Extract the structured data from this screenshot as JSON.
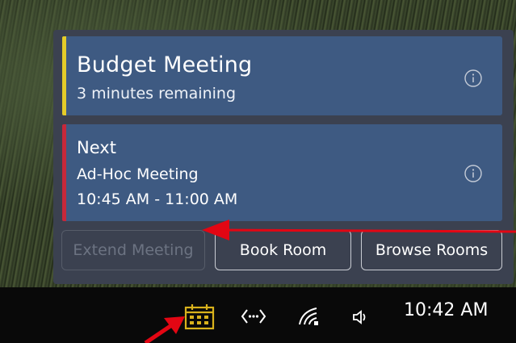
{
  "flyout": {
    "current": {
      "title": "Budget Meeting",
      "status": "3 minutes remaining",
      "accent_color": "#e4cc29",
      "icon": "info-icon"
    },
    "next": {
      "heading": "Next",
      "title": "Ad-Hoc Meeting",
      "time": "10:45 AM - 11:00 AM",
      "accent_color": "#c7283a",
      "icon": "info-icon"
    },
    "buttons": {
      "extend": "Extend Meeting",
      "book": "Book Room",
      "browse": "Browse Rooms"
    }
  },
  "taskbar": {
    "icons": [
      "calendar-icon",
      "code-icon",
      "network-icon",
      "volume-icon"
    ],
    "calendar_color": "#d9b21c",
    "clock": "10:42 AM"
  },
  "annotations": {
    "arrow_color": "#e30613"
  }
}
